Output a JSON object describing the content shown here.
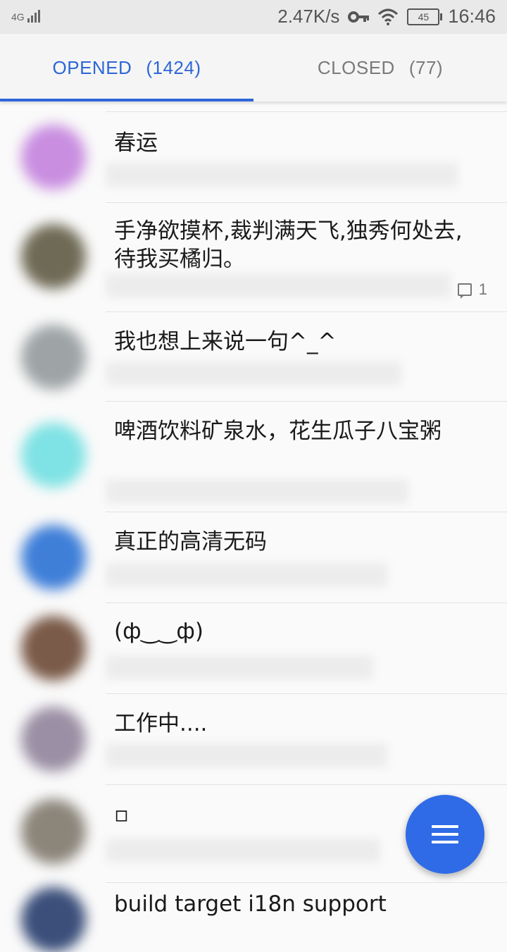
{
  "status_bar": {
    "network": "4G",
    "speed": "2.47K/s",
    "battery": "45",
    "time": "16:46",
    "icons": [
      "signal-icon",
      "key-icon",
      "wifi-icon",
      "battery-icon"
    ]
  },
  "tabs": [
    {
      "label": "OPENED",
      "count": "(1424)",
      "active": true
    },
    {
      "label": "CLOSED",
      "count": "(77)",
      "active": false
    }
  ],
  "issues": [
    {
      "title": "春运",
      "avatar_color": "#c98ee0"
    },
    {
      "title": "手净欲摸杯,裁判满天飞,独秀何处去,待我买橘归。",
      "avatar_color": "#6f6a55",
      "comments": "1"
    },
    {
      "title": "我也想上来说一句^_^",
      "avatar_color": "#9ea4a6"
    },
    {
      "title": "啤酒饮料矿泉水，花生瓜子八宝粥",
      "avatar_color": "#7fe2e4"
    },
    {
      "title": "真正的高清无码",
      "avatar_color": "#3f7fd8"
    },
    {
      "title": "(ф‿‿ф)",
      "avatar_color": "#7a5a48"
    },
    {
      "title": "工作中....",
      "avatar_color": "#9a8fa4"
    },
    {
      "title": "▫",
      "avatar_color": "#8b857a"
    },
    {
      "title": "build target i18n support",
      "avatar_color": "#3b4f7a"
    }
  ],
  "colors": {
    "accent": "#2e66d8",
    "fab": "#2f6be6"
  },
  "fab_icon": "menu-icon"
}
